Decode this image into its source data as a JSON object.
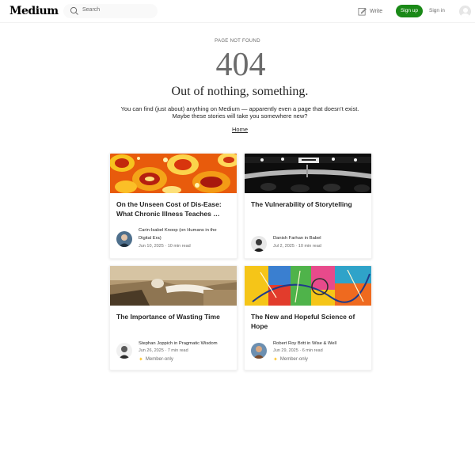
{
  "header": {
    "logo": "Medium",
    "search_placeholder": "Search",
    "write_label": "Write",
    "signup_label": "Sign up",
    "signin_label": "Sign in"
  },
  "not_found": {
    "label": "PAGE NOT FOUND",
    "code": "404",
    "title": "Out of nothing, something.",
    "description_line1": "You can find (just about) anything on Medium — apparently even a page that doesn’t exist.",
    "description_line2": "Maybe these stories will take you somewhere new?",
    "home_link": "Home"
  },
  "stories": [
    {
      "title": "On the Unseen Cost of Dis-Ease: What Chronic Illness Teaches …",
      "author_line1": "Carin-Isabel Knoop (on Humans in the",
      "author_line2": "Digital Era)",
      "meta": "Jun 10, 2025 · 10 min read",
      "member_only": "",
      "image": "orange-abstract-pattern"
    },
    {
      "title": "The Vulnerability of Storytelling",
      "author_line1": "Danish Farhan in Babel",
      "author_line2": "",
      "meta": "Jul 2, 2025 · 10 min read",
      "member_only": "",
      "image": "dark-stage-audience"
    },
    {
      "title": "The Importance of Wasting Time",
      "author_line1": "Stephan Joppich in Pragmatic Wisdom",
      "author_line2": "",
      "meta": "Jun 26, 2025 · 7 min read",
      "member_only": "Member-only",
      "image": "sepia-relaxing-person"
    },
    {
      "title": "The New and Hopeful Science of Hope",
      "author_line1": "Robert Roy Britt in Wise & Well",
      "author_line2": "",
      "meta": "Jun 29, 2025 · 6 min read",
      "member_only": "Member-only",
      "image": "colorful-abstract-painting"
    }
  ],
  "colors": {
    "brand_green": "#1a8917",
    "member_star": "#ffc017",
    "text_primary": "#242424",
    "text_secondary": "#6b6b6b"
  }
}
